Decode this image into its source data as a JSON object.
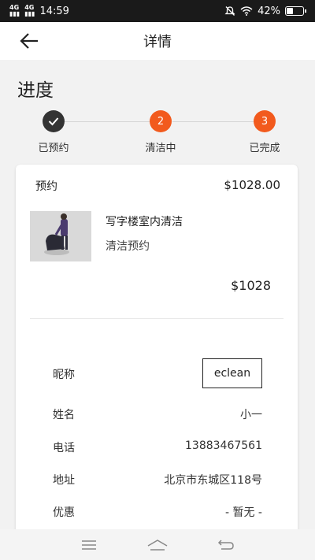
{
  "status_bar": {
    "signal_left": "4G",
    "signal_right": "4G",
    "time": "14:59",
    "battery": "42%",
    "battery_level": 0.42,
    "icons": [
      "signal-icon",
      "mute-icon",
      "wifi-icon",
      "battery-icon"
    ]
  },
  "header": {
    "title": "详情",
    "back_icon": "arrow-left-icon"
  },
  "progress": {
    "title": "进度",
    "steps": [
      {
        "label": "已预约",
        "marker": "✓",
        "state": "done"
      },
      {
        "label": "清洁中",
        "marker": "2",
        "state": "current"
      },
      {
        "label": "已完成",
        "marker": "3",
        "state": "pending"
      }
    ],
    "colors": {
      "done": "#333333",
      "active": "#f25a1d"
    }
  },
  "order": {
    "type_label": "预约",
    "total": "$1028.00",
    "service_name": "写字楼室内清洁",
    "service_type": "清洁预约",
    "service_price": "$1028"
  },
  "info": {
    "nickname": {
      "label": "昵称",
      "value": "eclean"
    },
    "name": {
      "label": "姓名",
      "value": "小一"
    },
    "phone": {
      "label": "电话",
      "value": "13883467561"
    },
    "address": {
      "label": "地址",
      "value": "北京市东城区118号"
    },
    "discount": {
      "label": "优惠",
      "value": "- 暂无 -"
    }
  },
  "nav_bar": {
    "icons": [
      "menu-icon",
      "home-icon",
      "back-icon"
    ]
  }
}
